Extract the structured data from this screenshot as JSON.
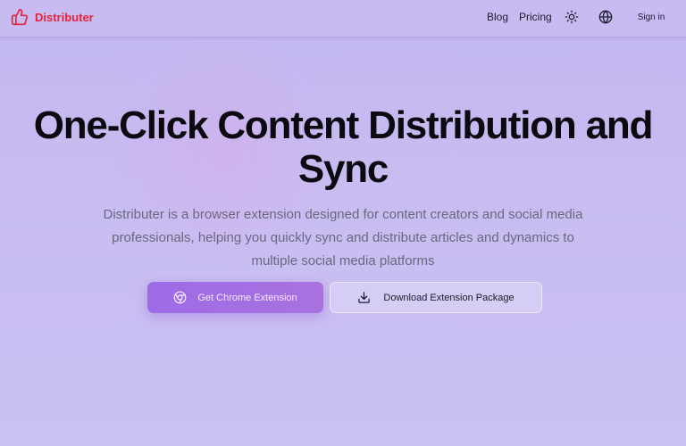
{
  "brand": {
    "name": "Distributer",
    "color": "#e8243b",
    "icon": "thumbs-up-icon"
  },
  "nav": {
    "blog": "Blog",
    "pricing": "Pricing",
    "theme_icon": "sun-icon",
    "language_icon": "globe-icon",
    "sign_in": "Sign in"
  },
  "hero": {
    "title": "One-Click Content Distribution and Sync",
    "subtitle": "Distributer is a browser extension designed for content creators and social media professionals, helping you quickly sync and distribute articles and dynamics to multiple social media platforms",
    "primary_button": {
      "label": "Get Chrome Extension",
      "icon": "chrome-icon"
    },
    "secondary_button": {
      "label": "Download Extension Package",
      "icon": "download-icon"
    }
  },
  "colors": {
    "accent": "#a06de4",
    "background": "#c6baf0"
  }
}
